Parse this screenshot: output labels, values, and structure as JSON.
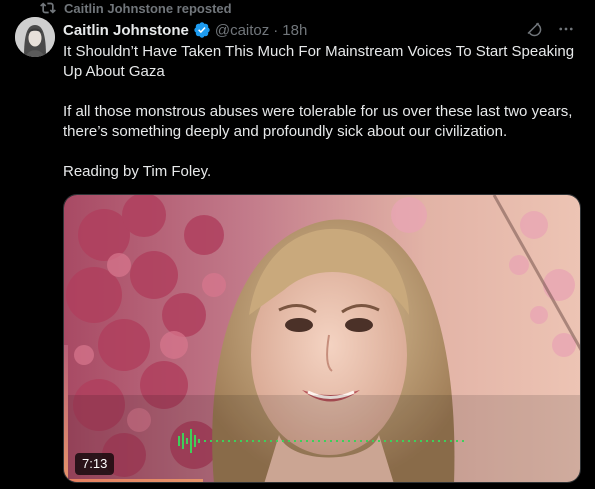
{
  "repost": {
    "label": "Caitlin Johnstone reposted",
    "icon": "repost-icon"
  },
  "author": {
    "name": "Caitlin Johnstone",
    "handle": "@caitoz",
    "separator": "·",
    "time": "18h",
    "verified_icon": "verified-badge-icon",
    "verified_color": "#1d9bf0"
  },
  "actions": {
    "grok_icon": "grok-icon",
    "more_icon": "more-icon",
    "more_label": "···"
  },
  "post": {
    "title_line": "It Shouldn’t Have Taken This Much For Mainstream Voices To Start Speaking Up About Gaza",
    "paragraph": "If all those monstrous abuses were tolerable for us over these last two years, there’s something deeply and profoundly sick about our civilization.",
    "credit": "Reading by Tim Foley."
  },
  "media": {
    "duration": "7:13",
    "waveform_color": "#3ecf5a",
    "progress_fraction": 0.27
  },
  "colors": {
    "background": "#000000",
    "text": "#e7e9ea",
    "muted": "#71767b"
  }
}
